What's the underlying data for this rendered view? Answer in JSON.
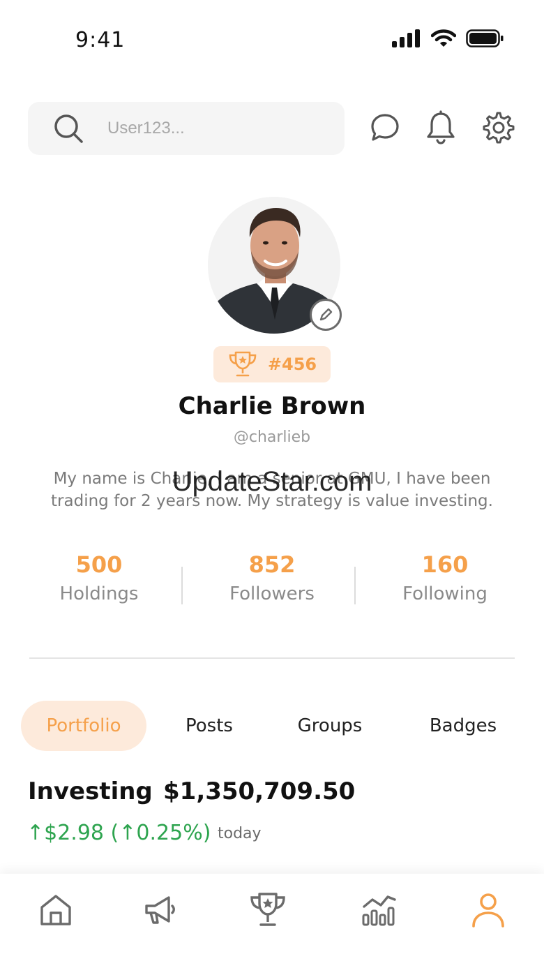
{
  "status_bar": {
    "time": "9:41"
  },
  "search": {
    "placeholder": "User123..."
  },
  "profile": {
    "rank": "#456",
    "name": "Charlie Brown",
    "handle": "@charlieb",
    "bio": "My name is Charlie, I am a senior at GMU, I have been trading for 2 years now. My strategy is value investing.",
    "watermark": "UpdateStar.com"
  },
  "stats": [
    {
      "value": "500",
      "label": "Holdings"
    },
    {
      "value": "852",
      "label": "Followers"
    },
    {
      "value": "160",
      "label": "Following"
    }
  ],
  "tabs": [
    {
      "label": "Portfolio",
      "active": true
    },
    {
      "label": "Posts",
      "active": false
    },
    {
      "label": "Groups",
      "active": false
    },
    {
      "label": "Badges",
      "active": false
    }
  ],
  "portfolio": {
    "title": "Investing",
    "value": "$1,350,709.50",
    "change": "↑$2.98 (↑0.25%)",
    "period": "today"
  },
  "colors": {
    "accent": "#f5a04a",
    "accent_bg": "#fdeadb",
    "positive": "#2ea44f",
    "icon": "#6b6b6b"
  },
  "nav": [
    "home-icon",
    "megaphone-icon",
    "trophy-icon",
    "chart-icon",
    "profile-icon"
  ]
}
